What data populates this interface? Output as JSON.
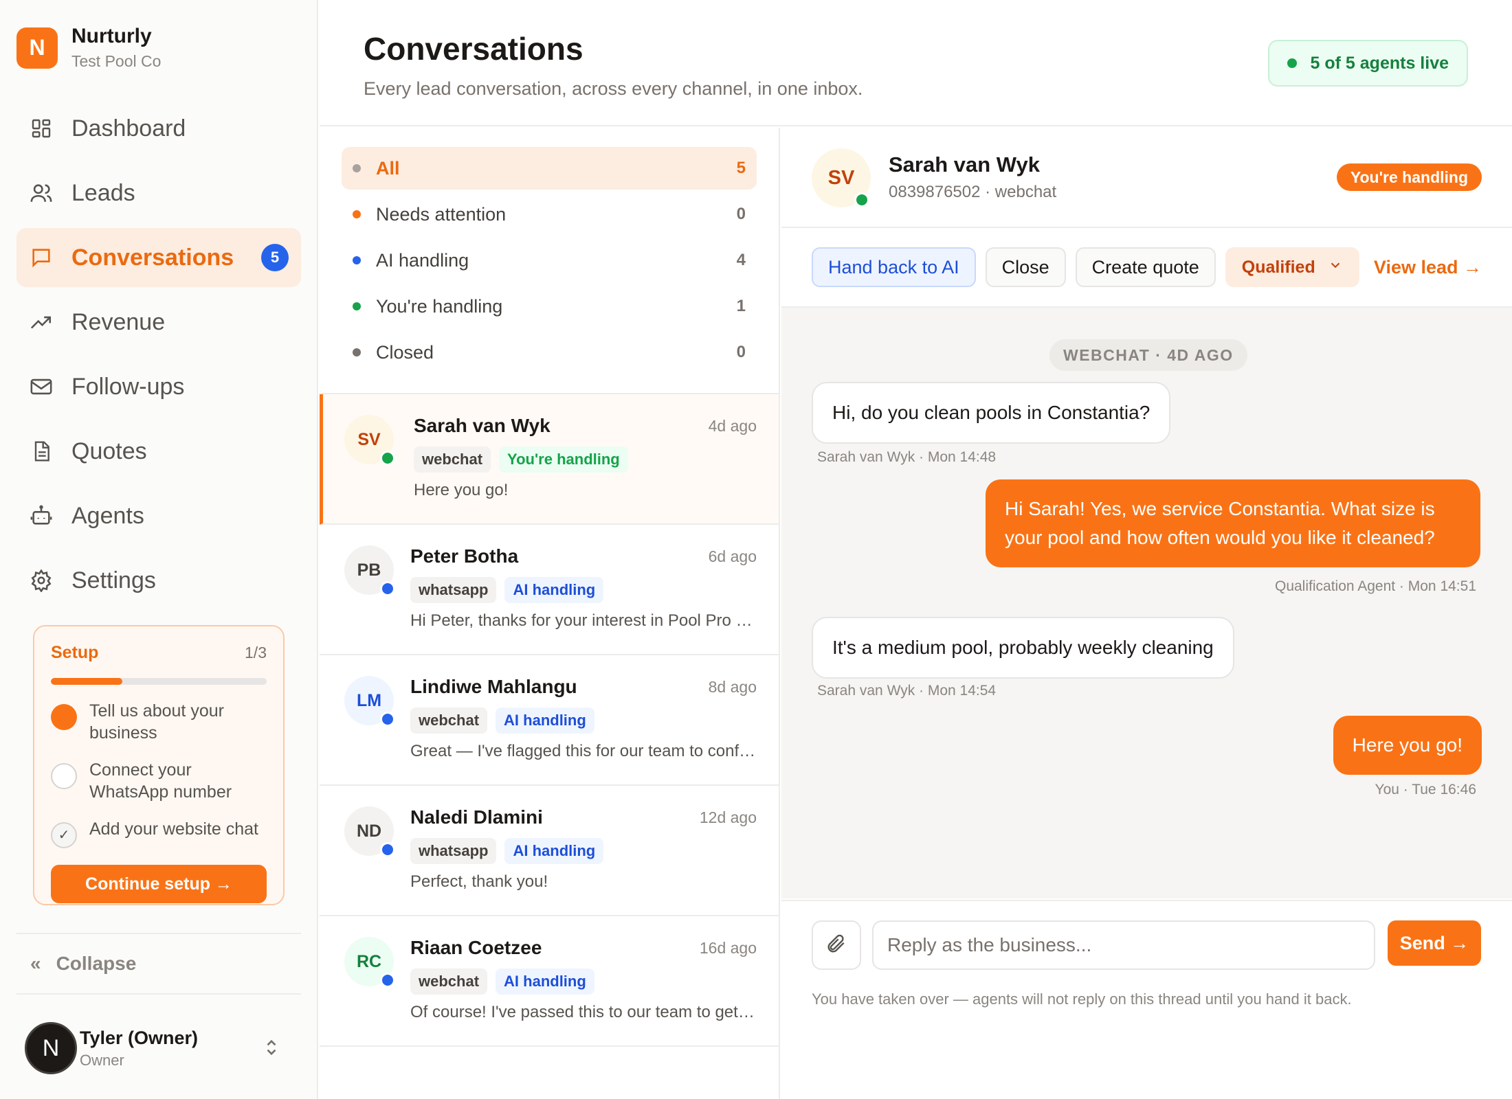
{
  "brand": {
    "initial": "N",
    "name": "Nurturly",
    "sub": "Test Pool Co"
  },
  "nav": [
    {
      "label": "Dashboard",
      "icon": "dashboard-icon"
    },
    {
      "label": "Leads",
      "icon": "users-icon"
    },
    {
      "label": "Conversations",
      "icon": "chat-icon",
      "badge": "5",
      "active": true
    },
    {
      "label": "Revenue",
      "icon": "trend-icon"
    },
    {
      "label": "Follow-ups",
      "icon": "mail-icon"
    },
    {
      "label": "Quotes",
      "icon": "document-icon"
    },
    {
      "label": "Agents",
      "icon": "robot-icon"
    },
    {
      "label": "Settings",
      "icon": "gear-icon"
    }
  ],
  "setup": {
    "title": "Setup",
    "count": "1/3",
    "progress": 0.33,
    "steps": [
      "Tell us about your business",
      "Connect your WhatsApp number",
      "Add your website chat"
    ],
    "button": "Continue setup →"
  },
  "collapse": {
    "label": "Collapse",
    "icon": "«"
  },
  "user": {
    "initial": "N",
    "name": "Tyler (Owner)",
    "role": "Owner"
  },
  "header": {
    "title": "Conversations",
    "subtitle": "Every lead conversation, across every channel, in one inbox.",
    "live": "5 of 5 agents live"
  },
  "filters": [
    {
      "label": "All",
      "count": "5",
      "color": "#a8a29e",
      "active": true
    },
    {
      "label": "Needs attention",
      "count": "0",
      "color": "#f97316"
    },
    {
      "label": "AI handling",
      "count": "4",
      "color": "#2563eb"
    },
    {
      "label": "You're handling",
      "count": "1",
      "color": "#16a34a"
    },
    {
      "label": "Closed",
      "count": "0",
      "color": "#78716c"
    }
  ],
  "conversations": [
    {
      "initials": "SV",
      "name": "Sarah van Wyk",
      "time": "4d ago",
      "channel": "webchat",
      "status": "You're handling",
      "preview": "Here you go!",
      "active": true
    },
    {
      "initials": "PB",
      "name": "Peter Botha",
      "time": "6d ago",
      "channel": "whatsapp",
      "status": "AI handling",
      "preview": "Hi Peter, thanks for your interest in Pool Pro Services! I'd love to help"
    },
    {
      "initials": "LM",
      "name": "Lindiwe Mahlangu",
      "time": "8d ago",
      "channel": "webchat",
      "status": "AI handling",
      "preview": "Great — I've flagged this for our team to confirm the details"
    },
    {
      "initials": "ND",
      "name": "Naledi Dlamini",
      "time": "12d ago",
      "channel": "whatsapp",
      "status": "AI handling",
      "preview": "Perfect, thank you!"
    },
    {
      "initials": "RC",
      "name": "Riaan Coetzee",
      "time": "16d ago",
      "channel": "webchat",
      "status": "AI handling",
      "preview": "Of course! I've passed this to our team to get back to you"
    }
  ],
  "chat": {
    "initials": "SV",
    "name": "Sarah van Wyk",
    "sub": "0839876502 · webchat",
    "handling": "You're handling",
    "actions": {
      "hand_back": "Hand back to AI",
      "close": "Close",
      "quote": "Create quote",
      "stage": "Qualified",
      "view_lead": "View lead →"
    },
    "separator": "WEBCHAT · 4D AGO",
    "messages": [
      {
        "dir": "in",
        "text": "Hi, do you clean pools in Constantia?",
        "meta": "Sarah van Wyk · Mon 14:48"
      },
      {
        "dir": "out",
        "text": "Hi Sarah! Yes, we service Constantia. What size is your pool and how often would you like it cleaned?",
        "meta": "Qualification Agent · Mon 14:51"
      },
      {
        "dir": "in",
        "text": "It's a medium pool, probably weekly cleaning",
        "meta": "Sarah van Wyk · Mon 14:54"
      },
      {
        "dir": "out",
        "text": "Here you go!",
        "meta": "You · Tue 16:46"
      }
    ],
    "composer": {
      "placeholder": "Reply as the business...",
      "send": "Send →",
      "note": "You have taken over — agents will not reply on this thread until you hand it back."
    }
  }
}
